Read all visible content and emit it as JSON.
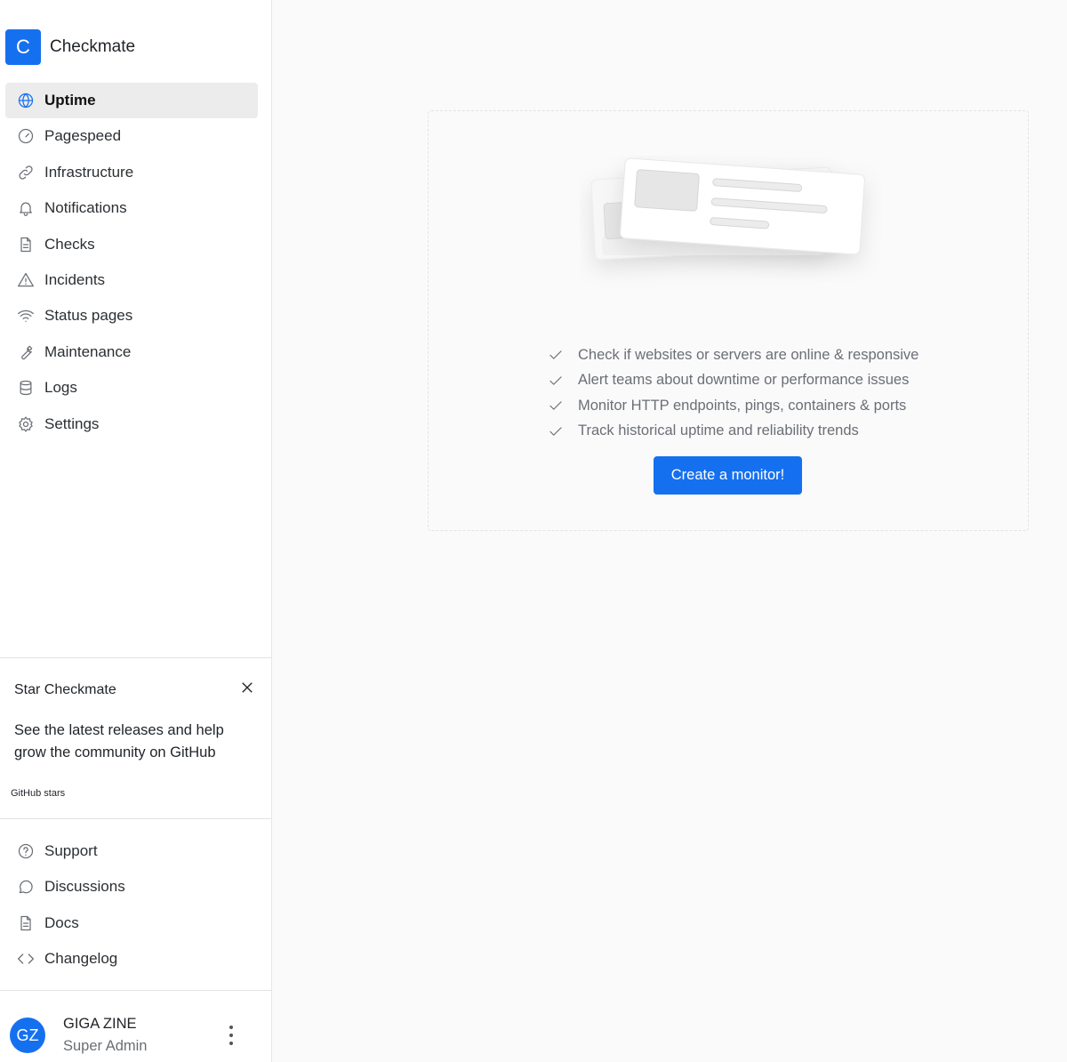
{
  "brand": {
    "logo_letter": "C",
    "name": "Checkmate",
    "accent": "#1570ef"
  },
  "nav": [
    {
      "label": "Uptime",
      "icon": "globe-icon",
      "active": true
    },
    {
      "label": "Pagespeed",
      "icon": "gauge-icon"
    },
    {
      "label": "Infrastructure",
      "icon": "link-icon"
    },
    {
      "label": "Notifications",
      "icon": "bell-icon"
    },
    {
      "label": "Checks",
      "icon": "document-icon"
    },
    {
      "label": "Incidents",
      "icon": "warning-icon"
    },
    {
      "label": "Status pages",
      "icon": "wifi-icon"
    },
    {
      "label": "Maintenance",
      "icon": "wrench-icon"
    },
    {
      "label": "Logs",
      "icon": "database-icon"
    },
    {
      "label": "Settings",
      "icon": "gear-icon"
    }
  ],
  "star_card": {
    "title": "Star Checkmate",
    "description": "See the latest releases and help grow the community on GitHub",
    "stars_label": "GitHub stars"
  },
  "links": [
    {
      "label": "Support",
      "icon": "question-icon"
    },
    {
      "label": "Discussions",
      "icon": "chat-icon"
    },
    {
      "label": "Docs",
      "icon": "document-icon"
    },
    {
      "label": "Changelog",
      "icon": "code-icon"
    }
  ],
  "user": {
    "initials": "GZ",
    "name": "GIGA ZINE",
    "role": "Super Admin"
  },
  "empty_state": {
    "features": [
      "Check if websites or servers are online & responsive",
      "Alert teams about downtime or performance issues",
      "Monitor HTTP endpoints, pings, containers & ports",
      "Track historical uptime and reliability trends"
    ],
    "button_label": "Create a monitor!"
  }
}
